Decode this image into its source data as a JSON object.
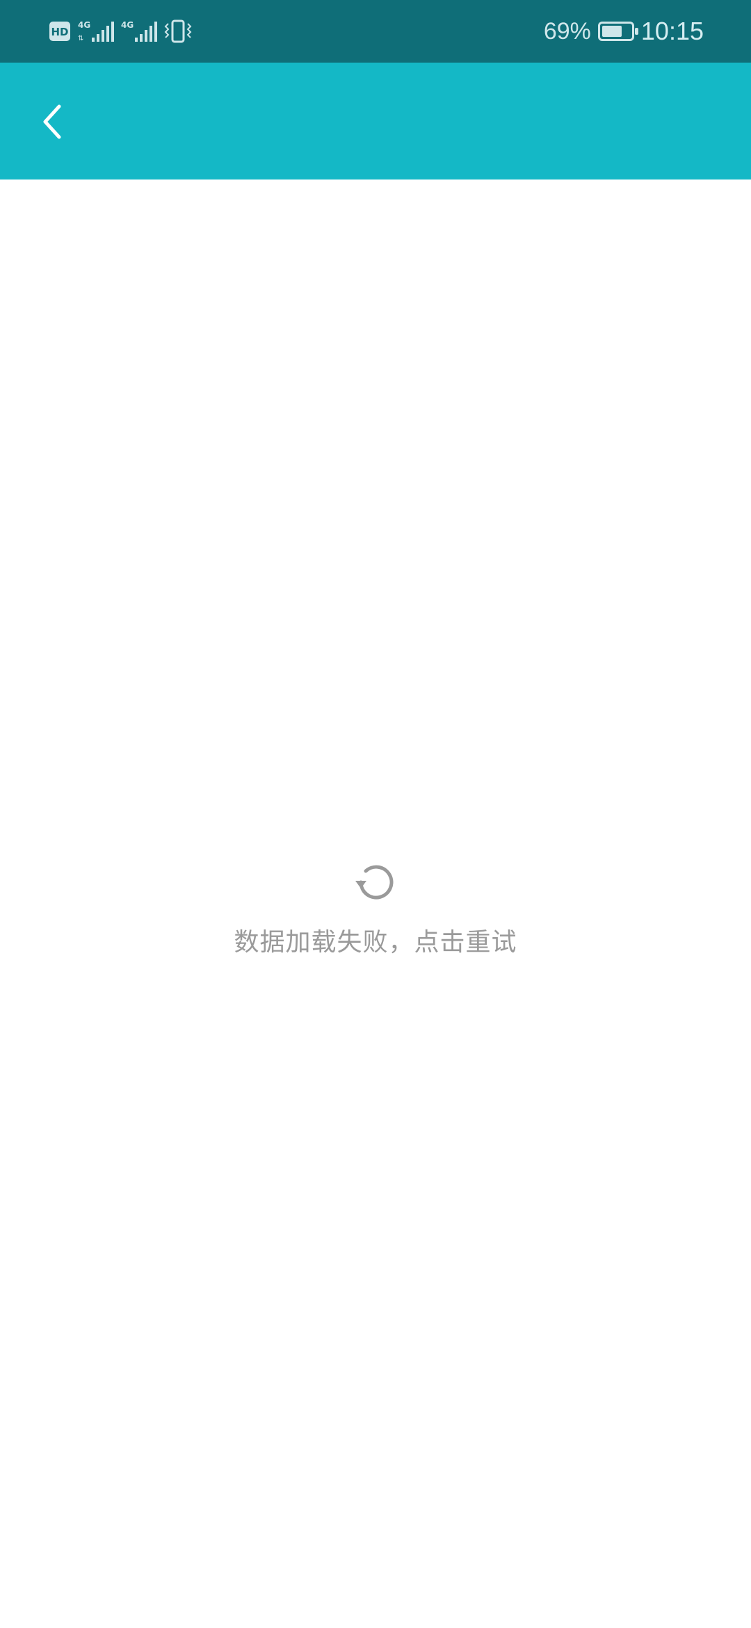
{
  "status_bar": {
    "left_indicators": {
      "hd_badge": "HD",
      "sim1_network": "4G",
      "sim2_network": "4G",
      "sim1_icon": "signal-bars-icon",
      "sim2_icon": "signal-bars-icon",
      "vibrate_icon": "vibrate-icon"
    },
    "battery_percent_text": "69%",
    "battery_level": 0.69,
    "time": "10:15"
  },
  "app_bar": {
    "back_icon": "chevron-left-icon",
    "background_color": "#14b8c6"
  },
  "error_state": {
    "icon": "refresh-icon",
    "message": "数据加载失败，点击重试"
  },
  "colors": {
    "status_bar": "#0f6e78",
    "accent": "#14b8c6",
    "muted_text": "#9a9a9a"
  }
}
